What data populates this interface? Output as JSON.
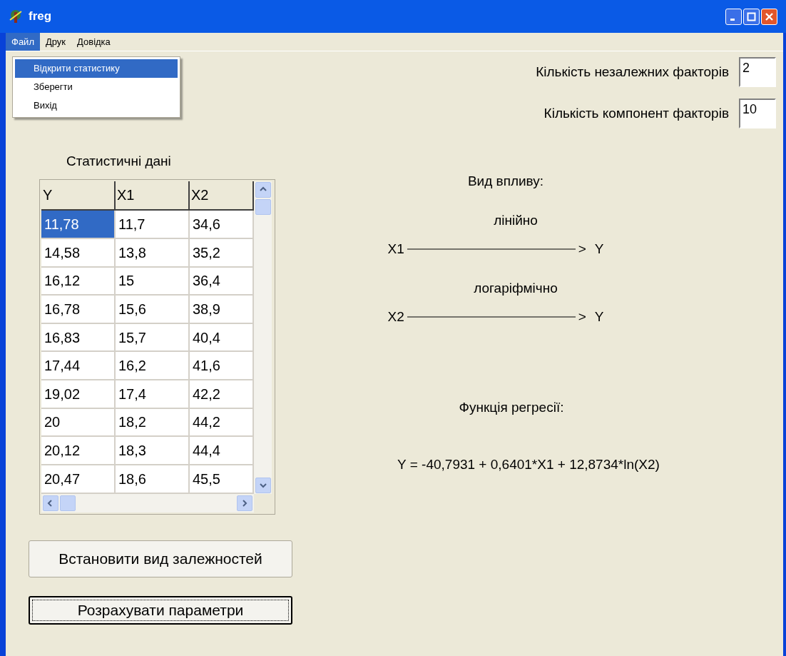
{
  "window": {
    "title": "freg"
  },
  "menu": [
    {
      "label": "Файл",
      "selected": true
    },
    {
      "label": "Друк",
      "selected": false
    },
    {
      "label": "Довідка",
      "selected": false
    }
  ],
  "dropdown": [
    {
      "label": "Відкрити статистику",
      "selected": true
    },
    {
      "label": "Зберегти",
      "selected": false
    },
    {
      "label": "Вихід",
      "selected": false
    }
  ],
  "table": {
    "title": "Статистичні дані",
    "columns": [
      "Y",
      "X1",
      "X2"
    ],
    "rows": [
      {
        "cells": [
          "11,78",
          "11,7",
          "34,6"
        ],
        "selected": [
          true,
          false,
          false
        ]
      },
      {
        "cells": [
          "14,58",
          "13,8",
          "35,2"
        ],
        "selected": [
          false,
          false,
          false
        ]
      },
      {
        "cells": [
          "16,12",
          "15",
          "36,4"
        ],
        "selected": [
          false,
          false,
          false
        ]
      },
      {
        "cells": [
          "16,78",
          "15,6",
          "38,9"
        ],
        "selected": [
          false,
          false,
          false
        ]
      },
      {
        "cells": [
          "16,83",
          "15,7",
          "40,4"
        ],
        "selected": [
          false,
          false,
          false
        ]
      },
      {
        "cells": [
          "17,44",
          "16,2",
          "41,6"
        ],
        "selected": [
          false,
          false,
          false
        ]
      },
      {
        "cells": [
          "19,02",
          "17,4",
          "42,2"
        ],
        "selected": [
          false,
          false,
          false
        ]
      },
      {
        "cells": [
          "20",
          "18,2",
          "44,2"
        ],
        "selected": [
          false,
          false,
          false
        ]
      },
      {
        "cells": [
          "20,12",
          "18,3",
          "44,4"
        ],
        "selected": [
          false,
          false,
          false
        ]
      },
      {
        "cells": [
          "20,47",
          "18,6",
          "45,5"
        ],
        "selected": [
          false,
          false,
          false
        ]
      }
    ]
  },
  "buttons": [
    {
      "label": "Встановити вид залежностей",
      "focused": false
    },
    {
      "label": "Розрахувати параметри",
      "focused": true
    }
  ],
  "fields": [
    {
      "label": "Кількість незалежних факторів",
      "value": "2"
    },
    {
      "label": "Кількість компонент факторів",
      "value": "10"
    }
  ],
  "influence": {
    "title": "Вид впливу:",
    "arrows": [
      {
        "type": "лінійно",
        "from": "X1",
        "head": ">",
        "to": "Y"
      },
      {
        "type": "логаріфмічно",
        "from": "X2",
        "head": ">",
        "to": "Y"
      }
    ]
  },
  "regression": {
    "title": "Функція регресії:",
    "formula": "Y = -40,7931 + 0,6401*X1 + 12,8734*ln(X2)"
  }
}
